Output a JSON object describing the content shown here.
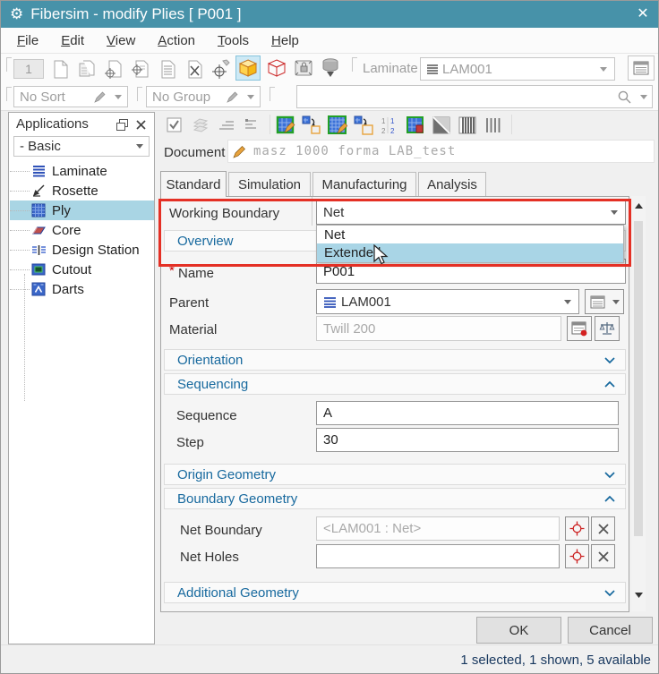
{
  "window": {
    "title": "Fibersim - modify Plies [ P001 ]"
  },
  "icons": {
    "gear": "⚙",
    "close": "✕",
    "required_asterisk": "*"
  },
  "menu": [
    "File",
    "Edit",
    "View",
    "Action",
    "Tools",
    "Help"
  ],
  "toolbar": {
    "count": "1",
    "laminate_label": "Laminate",
    "laminate_value": "LAM001"
  },
  "filters": {
    "sort": "No Sort",
    "group": "No Group",
    "search_value": ""
  },
  "sidebar": {
    "title": "Applications",
    "mode": "- Basic",
    "items": [
      {
        "label": "Laminate"
      },
      {
        "label": "Rosette"
      },
      {
        "label": "Ply",
        "selected": true
      },
      {
        "label": "Core"
      },
      {
        "label": "Design Station"
      },
      {
        "label": "Cutout"
      },
      {
        "label": "Darts"
      }
    ]
  },
  "document": {
    "label": "Document",
    "value": "masz 1000 forma LAB_test"
  },
  "tabs": [
    "Standard",
    "Simulation",
    "Manufacturing",
    "Analysis"
  ],
  "form": {
    "working_boundary": {
      "label": "Working Boundary",
      "value": "Net",
      "options": [
        "Net",
        "Extended"
      ],
      "highlighted_option": "Extended"
    },
    "overview": {
      "header": "Overview",
      "name_label": "Name",
      "name_value": "P001",
      "parent_label": "Parent",
      "parent_value": "LAM001",
      "material_label": "Material",
      "material_value": "Twill 200"
    },
    "orientation": {
      "header": "Orientation"
    },
    "sequencing": {
      "header": "Sequencing",
      "sequence_label": "Sequence",
      "sequence_value": "A",
      "step_label": "Step",
      "step_value": "30"
    },
    "origin_geometry": {
      "header": "Origin Geometry"
    },
    "boundary_geometry": {
      "header": "Boundary Geometry",
      "net_boundary_label": "Net Boundary",
      "net_boundary_value": "<LAM001 : Net>",
      "net_holes_label": "Net Holes",
      "net_holes_value": ""
    },
    "additional_geometry": {
      "header": "Additional Geometry"
    }
  },
  "buttons": {
    "ok": "OK",
    "cancel": "Cancel"
  },
  "status": "1 selected, 1 shown, 5 available"
}
